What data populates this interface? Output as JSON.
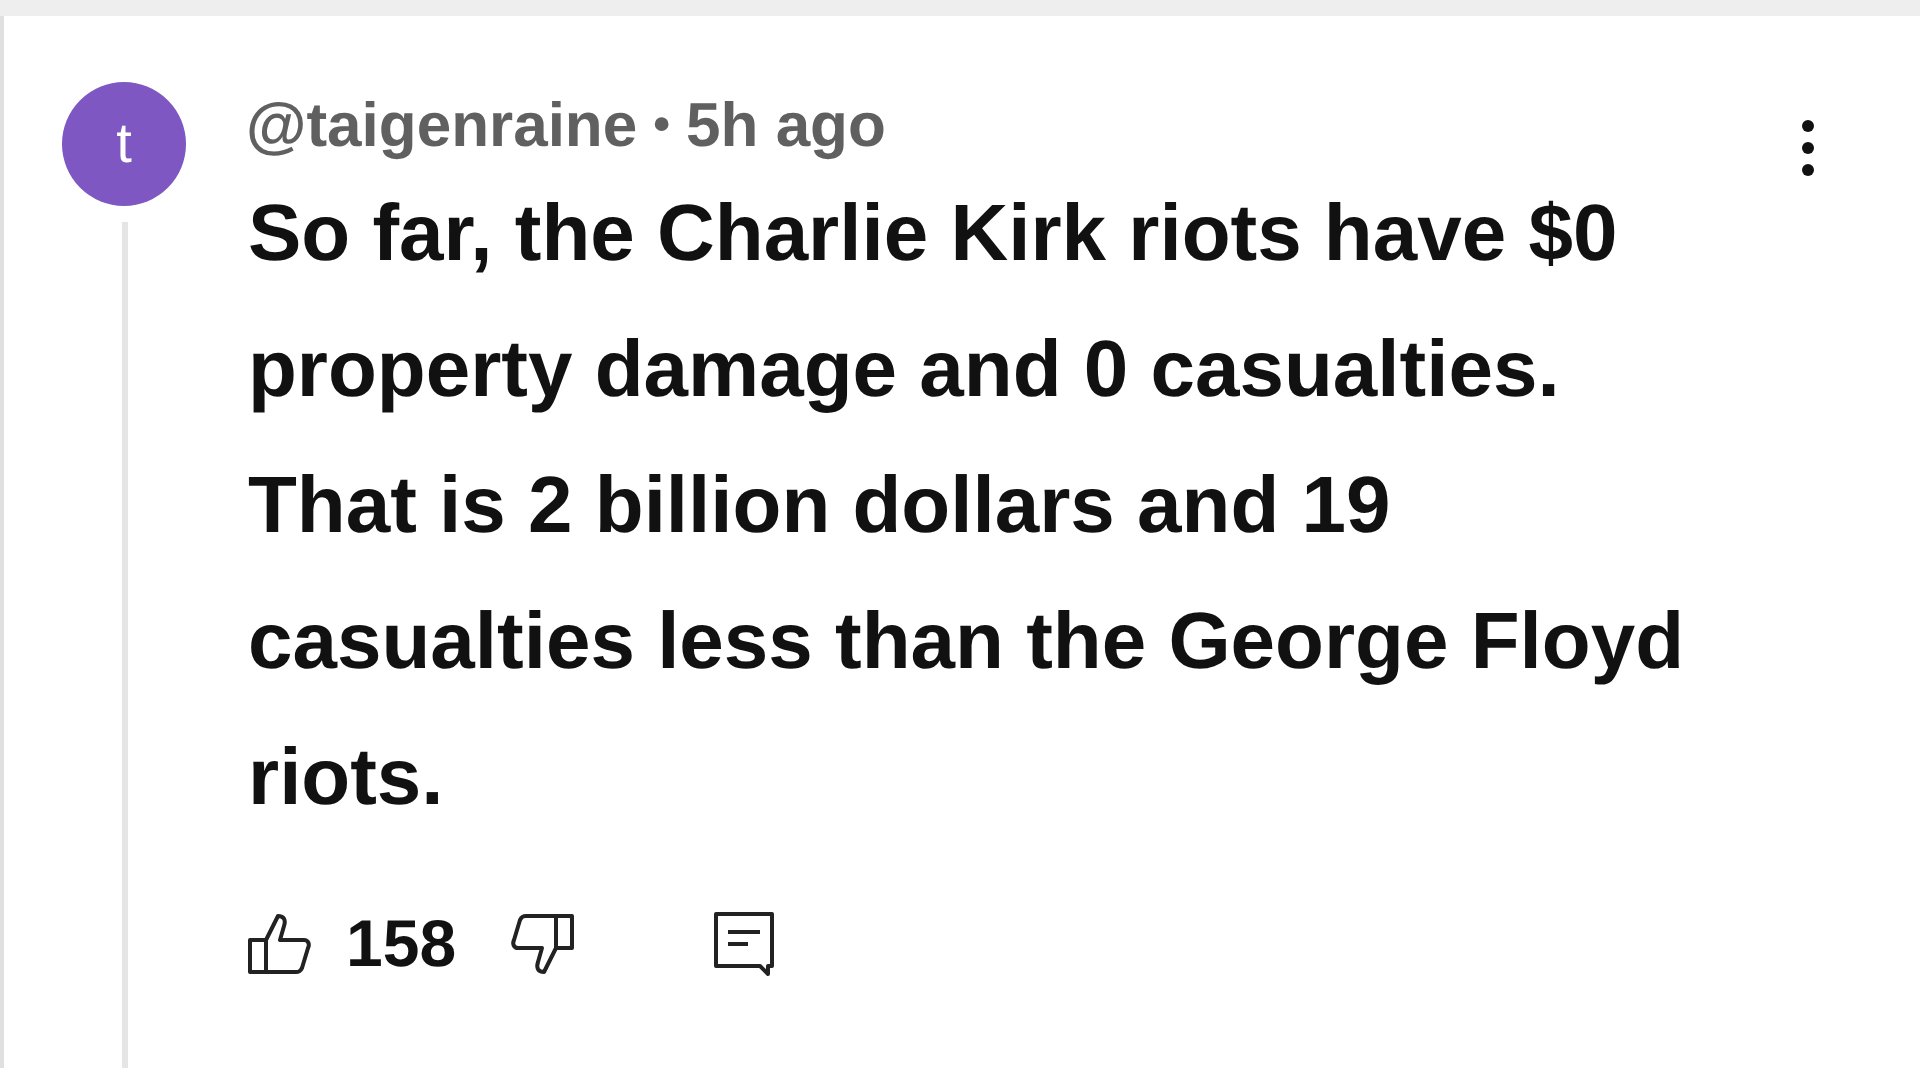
{
  "comment": {
    "avatar_letter": "t",
    "author": "@taigenraine",
    "separator": "•",
    "time": "5h ago",
    "text": "So far, the Charlie Kirk riots have $0 property damage and 0 casualties. That is 2 billion dollars and 19 casualties less than the George Floyd riots.",
    "likes": "158"
  }
}
